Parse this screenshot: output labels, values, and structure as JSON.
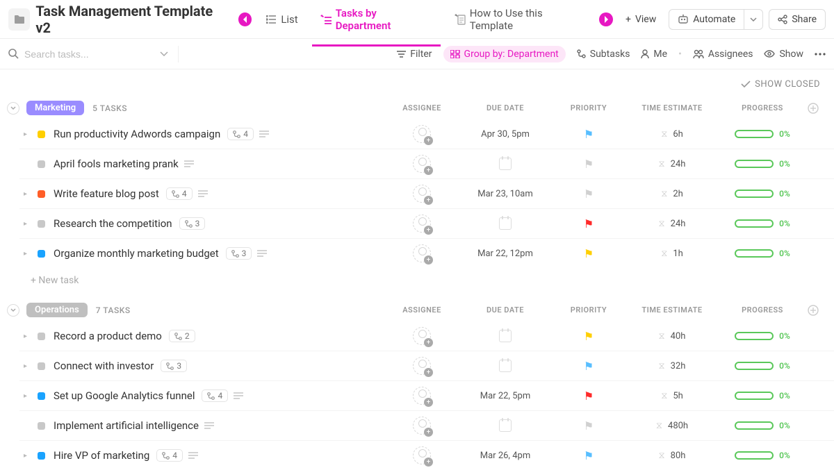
{
  "header": {
    "title": "Task Management Template v2",
    "tabs": [
      {
        "label": "List",
        "active": false
      },
      {
        "label": "Tasks by Department",
        "active": true
      },
      {
        "label": "How to Use this Template",
        "active": false
      }
    ],
    "add_view_label": "View",
    "automate_label": "Automate",
    "share_label": "Share"
  },
  "toolbar": {
    "search_placeholder": "Search tasks...",
    "filter_label": "Filter",
    "group_by_label": "Group by: Department",
    "subtasks_label": "Subtasks",
    "me_label": "Me",
    "assignees_label": "Assignees",
    "show_label": "Show"
  },
  "show_closed_label": "SHOW CLOSED",
  "columns": {
    "assignee": "ASSIGNEE",
    "due_date": "DUE DATE",
    "priority": "PRIORITY",
    "time_estimate": "TIME ESTIMATE",
    "progress": "PROGRESS"
  },
  "new_task_label": "+ New task",
  "groups": [
    {
      "name": "Marketing",
      "chip_class": "marketing",
      "count_label": "5 TASKS",
      "tasks": [
        {
          "status": "yellow",
          "expand": true,
          "name": "Run productivity Adwords campaign",
          "subtasks": "4",
          "desc": true,
          "due": "Apr 30, 5pm",
          "flag": "blue",
          "time": "6h",
          "progress": "0%"
        },
        {
          "status": "gray",
          "expand": false,
          "name": "April fools marketing prank",
          "subtasks": null,
          "desc": true,
          "due": null,
          "flag": "gray",
          "time": "24h",
          "progress": "0%"
        },
        {
          "status": "orange",
          "expand": true,
          "name": "Write feature blog post",
          "subtasks": "4",
          "desc": true,
          "due": "Mar 23, 10am",
          "flag": "gray",
          "time": "2h",
          "progress": "0%"
        },
        {
          "status": "gray",
          "expand": true,
          "name": "Research the competition",
          "subtasks": "3",
          "desc": false,
          "due": null,
          "flag": "red",
          "time": "24h",
          "progress": "0%"
        },
        {
          "status": "blue",
          "expand": true,
          "name": "Organize monthly marketing budget",
          "subtasks": "3",
          "desc": true,
          "due": "Mar 22, 12pm",
          "flag": "yellow",
          "time": "1h",
          "progress": "0%"
        }
      ]
    },
    {
      "name": "Operations",
      "chip_class": "operations",
      "count_label": "7 TASKS",
      "tasks": [
        {
          "status": "gray",
          "expand": true,
          "name": "Record a product demo",
          "subtasks": "2",
          "desc": false,
          "due": null,
          "flag": "yellow",
          "time": "40h",
          "progress": "0%"
        },
        {
          "status": "gray",
          "expand": true,
          "name": "Connect with investor",
          "subtasks": "3",
          "desc": false,
          "due": null,
          "flag": "blue",
          "time": "32h",
          "progress": "0%"
        },
        {
          "status": "blue",
          "expand": true,
          "name": "Set up Google Analytics funnel",
          "subtasks": "4",
          "desc": true,
          "due": "Mar 22, 5pm",
          "flag": "red",
          "time": "5h",
          "progress": "0%"
        },
        {
          "status": "gray",
          "expand": false,
          "name": "Implement artificial intelligence",
          "subtasks": null,
          "desc": true,
          "due": null,
          "flag": "gray",
          "time": "480h",
          "progress": "0%"
        },
        {
          "status": "blue",
          "expand": true,
          "name": "Hire VP of marketing",
          "subtasks": "4",
          "desc": true,
          "due": "Mar 26, 4pm",
          "flag": "blue",
          "time": "80h",
          "progress": "0%"
        }
      ]
    }
  ]
}
